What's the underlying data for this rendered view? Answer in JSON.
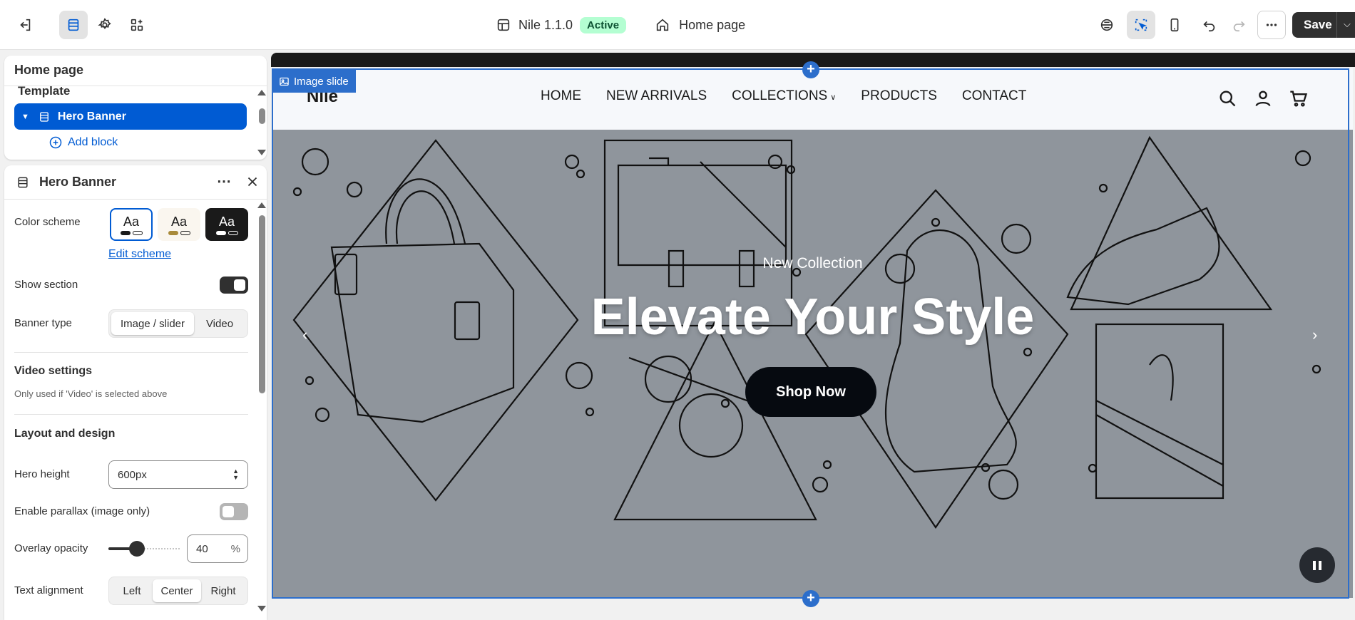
{
  "topbar": {
    "theme_name": "Nile 1.1.0",
    "theme_status": "Active",
    "page_selector": "Home page",
    "save_label": "Save"
  },
  "panel_sections": {
    "title": "Home page",
    "template_label": "Template",
    "selected_section": "Hero Banner",
    "add_block_label": "Add block"
  },
  "settings": {
    "title": "Hero Banner",
    "color_scheme_label": "Color scheme",
    "swatches": [
      {
        "label": "Aa",
        "bg": "#ffffff",
        "fg": "#1a1a1a"
      },
      {
        "label": "Aa",
        "bg": "#faf6ef",
        "fg": "#1a1a1a"
      },
      {
        "label": "Aa",
        "bg": "#1a1a1a",
        "fg": "#ffffff"
      }
    ],
    "edit_scheme_label": "Edit scheme",
    "show_section_label": "Show section",
    "show_section": true,
    "banner_type_label": "Banner type",
    "banner_type_options": [
      "Image / slider",
      "Video"
    ],
    "banner_type_selected": "Image / slider",
    "video_settings_heading": "Video settings",
    "video_settings_help": "Only used if 'Video' is selected above",
    "layout_heading": "Layout and design",
    "hero_height_label": "Hero height",
    "hero_height_value": "600px",
    "parallax_label": "Enable parallax (image only)",
    "parallax": false,
    "overlay_opacity_label": "Overlay opacity",
    "overlay_opacity_value": "40",
    "overlay_opacity_unit": "%",
    "text_alignment_label": "Text alignment",
    "text_alignment_options": [
      "Left",
      "Center",
      "Right"
    ],
    "text_alignment_selected": "Center"
  },
  "preview": {
    "selection_tag": "Image slide",
    "store_logo": "Nile",
    "nav": [
      "HOME",
      "NEW ARRIVALS",
      "COLLECTIONS",
      "PRODUCTS",
      "CONTACT"
    ],
    "hero_subheading": "New Collection",
    "hero_heading": "Elevate Your Style",
    "hero_button": "Shop Now",
    "prev_arrow": "‹",
    "next_arrow": "›"
  },
  "colors": {
    "accent": "#005bd3",
    "selection_blue": "#2c6ecb",
    "hero_bg": "#8f959c",
    "active_badge": "#b4fed2"
  }
}
